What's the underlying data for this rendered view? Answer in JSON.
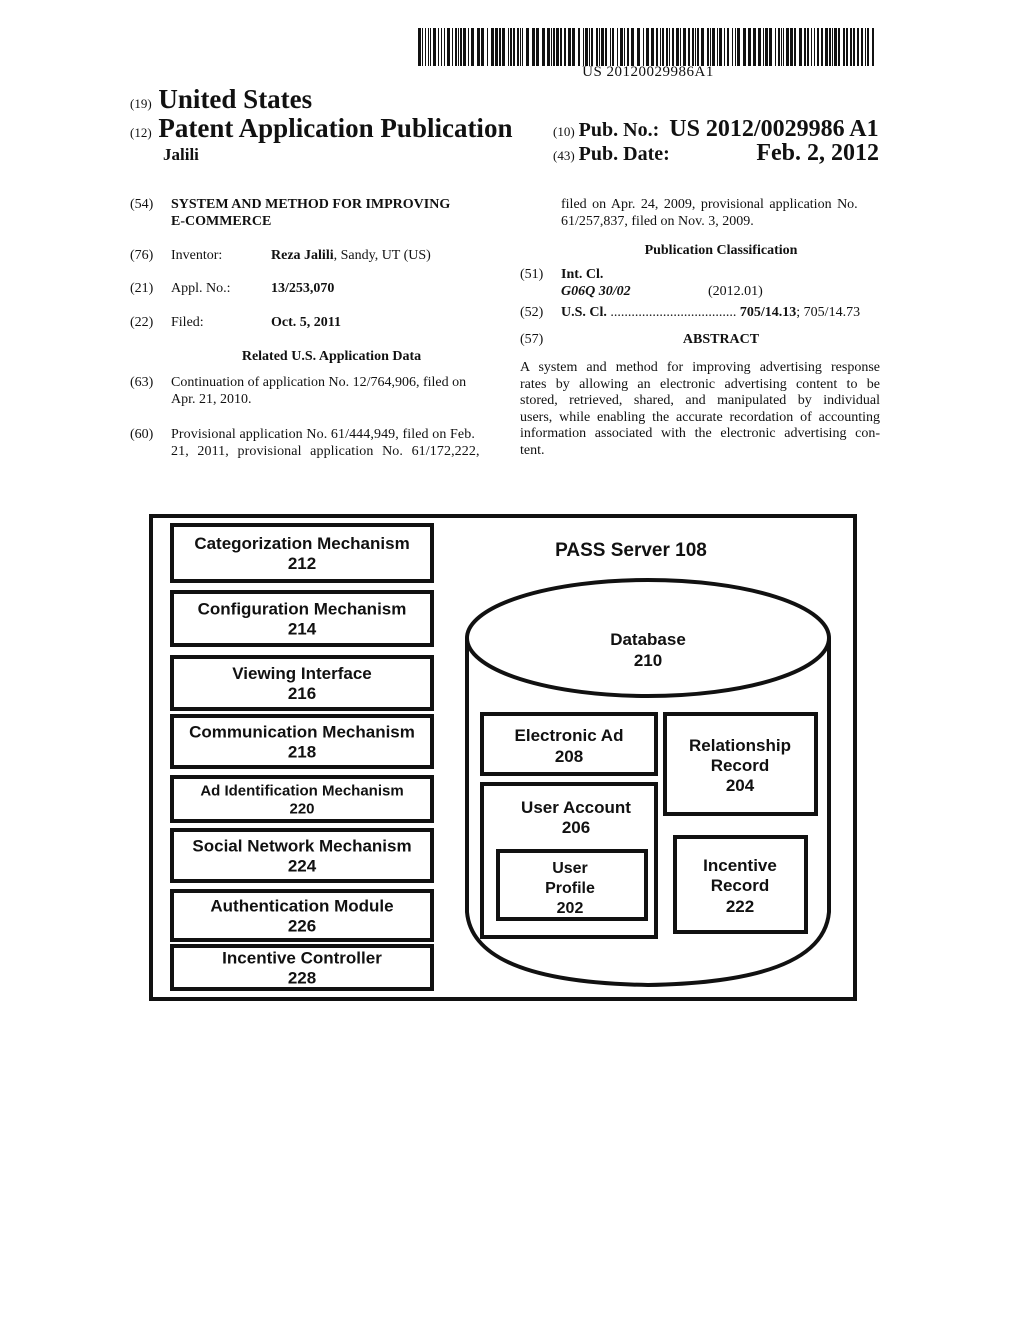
{
  "barcode": {
    "number": "US 20120029986A1"
  },
  "header": {
    "country_code": "(19)",
    "country": "United States",
    "type_code": "(12)",
    "type": "Patent Application Publication",
    "inventor_surname": "Jalili",
    "pub_no_code": "(10)",
    "pub_no_label": "Pub. No.:",
    "pub_no": "US 2012/0029986 A1",
    "pub_date_code": "(43)",
    "pub_date_label": "Pub. Date:",
    "pub_date": "Feb. 2, 2012"
  },
  "biblio": {
    "title": {
      "code": "(54)",
      "line1": "SYSTEM AND METHOD FOR IMPROVING",
      "line2": "E-COMMERCE"
    },
    "inventor": {
      "code": "(76)",
      "label": "Inventor:",
      "name": "Reza Jalili",
      "location": ", Sandy, UT (US)"
    },
    "appl_no": {
      "code": "(21)",
      "label": "Appl. No.:",
      "value": "13/253,070"
    },
    "filed": {
      "code": "(22)",
      "label": "Filed:",
      "value": "Oct. 5, 2011"
    },
    "related_heading": "Related U.S. Application Data",
    "continuation": {
      "code": "(63)",
      "line1": "Continuation of application No. 12/764,906, filed on",
      "line2": "Apr. 21, 2010."
    },
    "provisional": {
      "code": "(60)",
      "line1": "Provisional application No. 61/444,949, filed on Feb.",
      "line2": "21, 2011, provisional application No. 61/172,222,",
      "line3": "filed on Apr. 24, 2009, provisional application No.",
      "line4": "61/257,837, filed on Nov. 3, 2009."
    },
    "classification_heading": "Publication Classification",
    "int_cl": {
      "code": "(51)",
      "label": "Int. Cl.",
      "class": "G06Q 30/02",
      "version": "(2012.01)"
    },
    "us_cl": {
      "code": "(52)",
      "label": "U.S. Cl.",
      "dots": "....................................",
      "primary": "705/14.13",
      "secondary": "; 705/14.73"
    },
    "abstract": {
      "code": "(57)",
      "heading": "ABSTRACT",
      "lines": [
        "A system and method for improving advertising response",
        "rates by allowing an electronic advertising content to be",
        "stored, retrieved, shared, and manipulated by individual",
        "users, while enabling the accurate recordation of accounting",
        "information associated with the electronic advertising con-",
        "tent."
      ]
    }
  },
  "figure": {
    "server_title": "PASS Server 108",
    "modules": [
      {
        "name": "Categorization Mechanism",
        "ref": "212"
      },
      {
        "name": "Configuration Mechanism",
        "ref": "214"
      },
      {
        "name": "Viewing Interface",
        "ref": "216"
      },
      {
        "name": "Communication Mechanism",
        "ref": "218"
      },
      {
        "name": "Ad Identification Mechanism",
        "ref": "220"
      },
      {
        "name": "Social Network Mechanism",
        "ref": "224"
      },
      {
        "name": "Authentication Module",
        "ref": "226"
      },
      {
        "name": "Incentive Controller",
        "ref": "228"
      }
    ],
    "database": {
      "name": "Database",
      "ref": "210"
    },
    "records": {
      "electronic_ad": {
        "name": "Electronic Ad",
        "ref": "208"
      },
      "user_account": {
        "name": "User Account",
        "ref": "206"
      },
      "user_profile": {
        "line1": "User",
        "line2": "Profile",
        "ref": "202"
      },
      "relationship_record": {
        "line1": "Relationship",
        "line2": "Record",
        "ref": "204"
      },
      "incentive_record": {
        "line1": "Incentive",
        "line2": "Record",
        "ref": "222"
      }
    }
  }
}
